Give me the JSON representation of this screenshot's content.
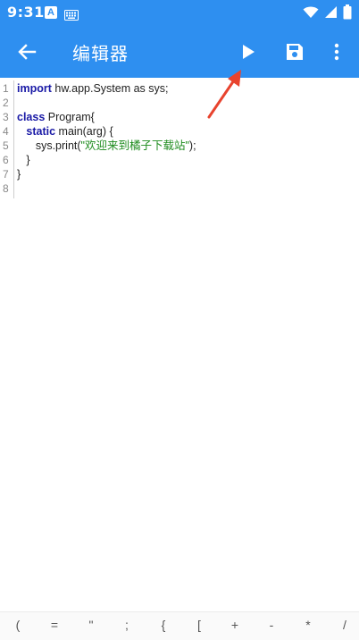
{
  "status": {
    "time": "9:31",
    "a_badge": "A"
  },
  "toolbar": {
    "title": "编辑器"
  },
  "editor": {
    "line_numbers": [
      "1",
      "2",
      "3",
      "4",
      "5",
      "6",
      "7",
      "8"
    ],
    "lines": {
      "l1_kw": "import",
      "l1_rest": " hw.app.System as sys;",
      "l3_kw": "class",
      "l3_rest": " Program{",
      "l4_indent": "   ",
      "l4_kw": "static",
      "l4_rest": " main(arg) {",
      "l5_pre": "      sys.print(",
      "l5_str": "\"欢迎来到橘子下载站\"",
      "l5_post": ");",
      "l6": "   }",
      "l7": "}"
    }
  },
  "symbols": [
    "(",
    "=",
    "\"",
    ";",
    "{",
    "[",
    "+",
    "-",
    "*",
    "/"
  ],
  "colors": {
    "primary": "#2e8ff0",
    "keyword": "#1a1aa6",
    "string": "#1e8c1e",
    "annotation": "#e8432e"
  }
}
